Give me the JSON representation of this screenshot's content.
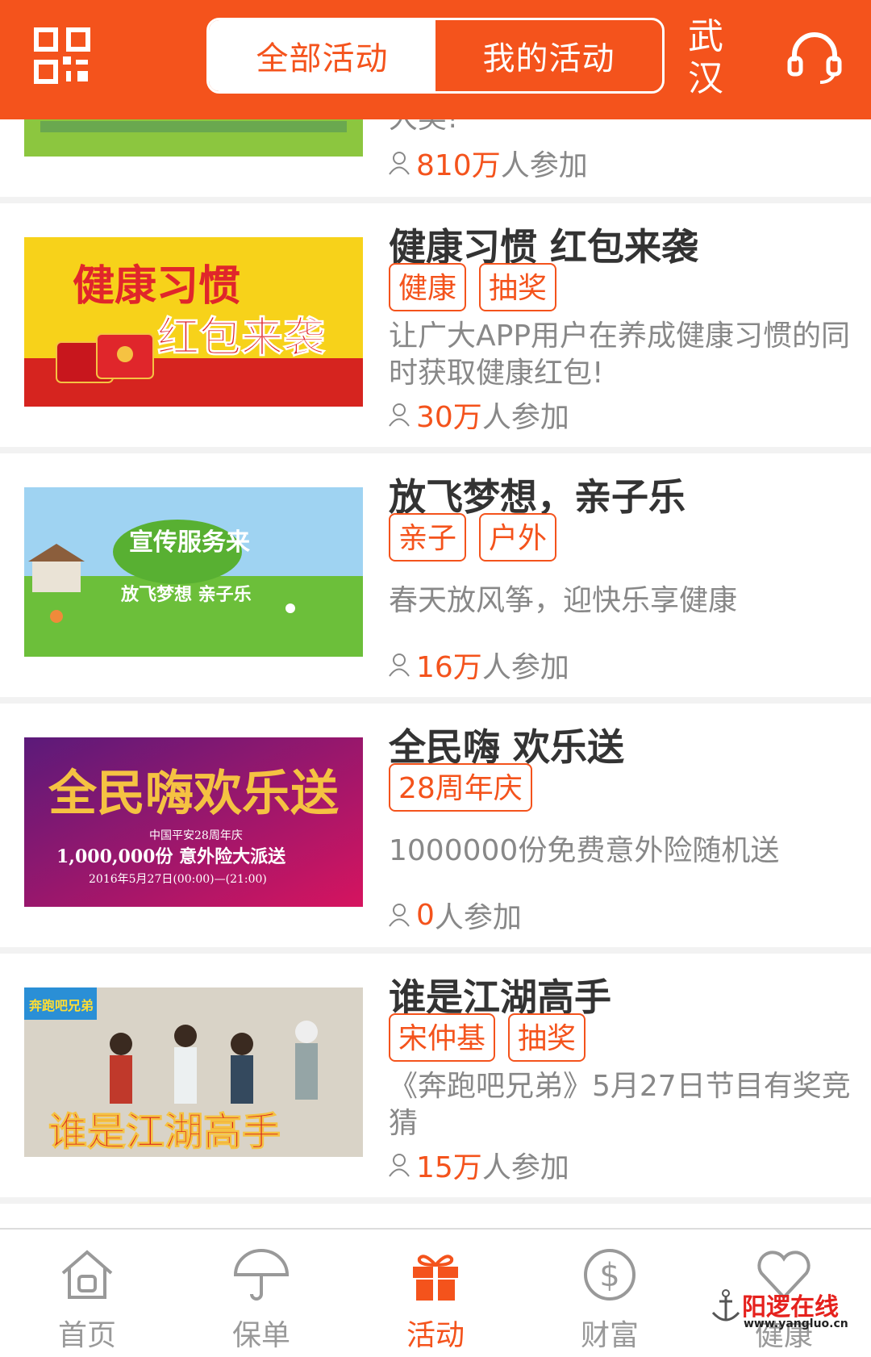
{
  "header": {
    "tabs": [
      {
        "label": "全部活动",
        "active": true
      },
      {
        "label": "我的活动",
        "active": false
      }
    ],
    "city": "武汉",
    "accent_color": "#f4531c"
  },
  "partial_top": {
    "desc_tail": "大奖!",
    "participants_num": "810万",
    "participants_suffix": "人参加"
  },
  "activities": [
    {
      "title": "健康习惯 红包来袭",
      "tags": [
        "健康",
        "抽奖"
      ],
      "desc": "让广大APP用户在养成健康习惯的同时获取健康红包!",
      "participants_num": "30万",
      "participants_suffix": "人参加",
      "banner": {
        "line1": "健康习惯",
        "line2": "红包来袭"
      }
    },
    {
      "title": "放飞梦想，亲子乐",
      "tags": [
        "亲子",
        "户外"
      ],
      "desc": "春天放风筝，迎快乐享健康",
      "participants_num": "16万",
      "participants_suffix": "人参加",
      "banner": {
        "line1": "宣传服务来",
        "line2": "放飞梦想 亲子乐"
      }
    },
    {
      "title": "全民嗨 欢乐送",
      "tags": [
        "28周年庆"
      ],
      "desc": "1000000份免费意外险随机送",
      "participants_num": "0",
      "participants_suffix": "人参加",
      "banner": {
        "line1": "全民嗨欢乐送",
        "line2": "中国平安28周年庆",
        "line3": "1,000,000份 意外险大派送",
        "line4": "2016年5月27日(00:00)—(21:00)"
      }
    },
    {
      "title": "谁是江湖高手",
      "tags": [
        "宋仲基",
        "抽奖"
      ],
      "desc": "《奔跑吧兄弟》5月27日节目有奖竞猜",
      "participants_num": "15万",
      "participants_suffix": "人参加",
      "banner": {
        "line1": "谁是江湖高手",
        "line2": "奔跑吧兄弟"
      }
    }
  ],
  "nav": [
    {
      "label": "首页",
      "icon": "home-icon",
      "active": false
    },
    {
      "label": "保单",
      "icon": "umbrella-icon",
      "active": false
    },
    {
      "label": "活动",
      "icon": "gift-icon",
      "active": true
    },
    {
      "label": "财富",
      "icon": "dollar-icon",
      "active": false
    },
    {
      "label": "健康",
      "icon": "heart-icon",
      "active": false
    }
  ],
  "watermark": {
    "name": "阳逻在线",
    "url": "www.yangluo.cn"
  }
}
